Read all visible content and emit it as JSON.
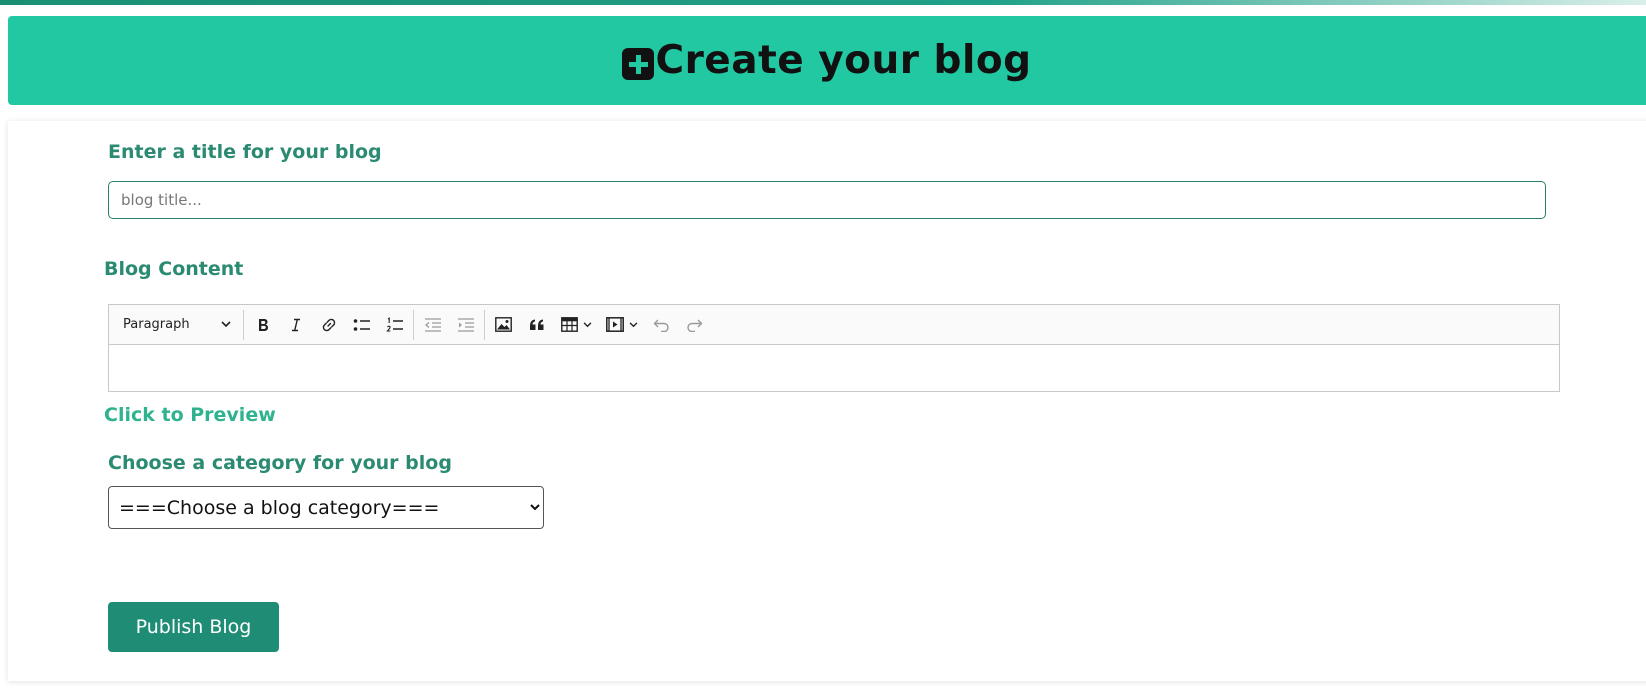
{
  "header": {
    "icon": "plus-square-icon",
    "title": "Create your blog"
  },
  "title_section": {
    "label": "Enter a title for your blog",
    "input_value": "",
    "input_placeholder": "blog title..."
  },
  "content_section": {
    "label": "Blog Content",
    "toolbar": {
      "heading_select": "Paragraph",
      "buttons": [
        "bold-icon",
        "italic-icon",
        "link-icon",
        "bulleted-list-icon",
        "numbered-list-icon",
        "outdent-icon",
        "indent-icon",
        "image-icon",
        "blockquote-icon",
        "table-icon",
        "media-icon",
        "undo-icon",
        "redo-icon"
      ]
    }
  },
  "preview": {
    "label": "Click to Preview"
  },
  "category_section": {
    "label": "Choose a category for your blog",
    "selected": "===Choose a blog category==="
  },
  "publish": {
    "label": "Publish Blog"
  },
  "colors": {
    "header_bg": "#21c8a2",
    "label": "#2b8a72",
    "preview_link": "#2fb38f",
    "button_bg": "#1f8d75"
  }
}
